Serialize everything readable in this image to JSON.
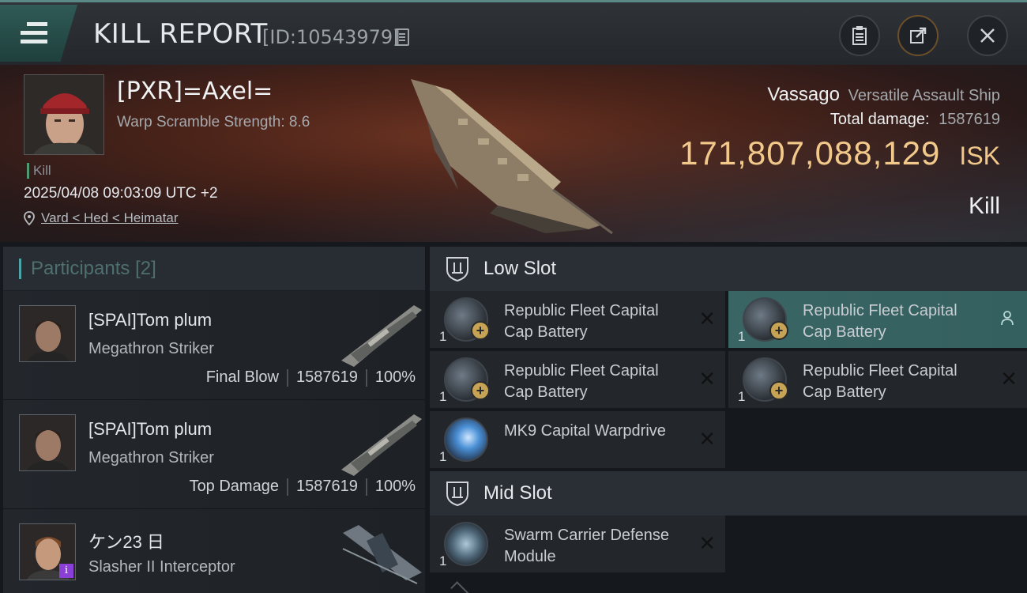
{
  "header": {
    "title": "KILL REPORT",
    "report_id": "[ID:10543979]"
  },
  "victim": {
    "name": "[PXR]=Axel=",
    "scramble": "Warp Scramble Strength: 8.6",
    "tag": "Kill",
    "timestamp": "2025/04/08 09:03:09 UTC +2",
    "location": "Vard < Hed < Heimatar",
    "ship_name": "Vassago",
    "ship_class": "Versatile Assault Ship",
    "total_damage_label": "Total damage:",
    "total_damage_value": "1587619",
    "isk_value": "171,807,088,129",
    "isk_unit": "ISK",
    "result": "Kill"
  },
  "participants": {
    "label": "Participants",
    "count": "[2]",
    "rows": [
      {
        "name": "[SPAI]Tom plum",
        "ship": "Megathron Striker",
        "role": "Final Blow",
        "damage": "1587619",
        "percent": "100%"
      },
      {
        "name": "[SPAI]Tom plum",
        "ship": "Megathron Striker",
        "role": "Top Damage",
        "damage": "1587619",
        "percent": "100%"
      },
      {
        "name": "ケン23 日",
        "ship": "Slasher II Interceptor",
        "badge": "i"
      }
    ]
  },
  "fitting": {
    "low_slot_label": "Low Slot",
    "mid_slot_label": "Mid Slot",
    "low_modules": [
      {
        "name": "Republic Fleet Capital Cap Battery",
        "qty": "1",
        "status": "destroyed"
      },
      {
        "name": "Republic Fleet Capital Cap Battery",
        "qty": "1",
        "status": "dropped"
      },
      {
        "name": "Republic Fleet Capital Cap Battery",
        "qty": "1",
        "status": "destroyed"
      },
      {
        "name": "Republic Fleet Capital Cap Battery",
        "qty": "1",
        "status": "destroyed"
      },
      {
        "name": "MK9 Capital Warpdrive",
        "qty": "1",
        "status": "destroyed"
      }
    ],
    "mid_modules": [
      {
        "name": "Swarm Carrier Defense Module",
        "qty": "1",
        "status": "destroyed"
      }
    ],
    "x_glyph": "✕"
  },
  "colors": {
    "accent": "#4ea4a4",
    "isk_gold": "#f2c98a",
    "selected_row": "#3a6565"
  }
}
